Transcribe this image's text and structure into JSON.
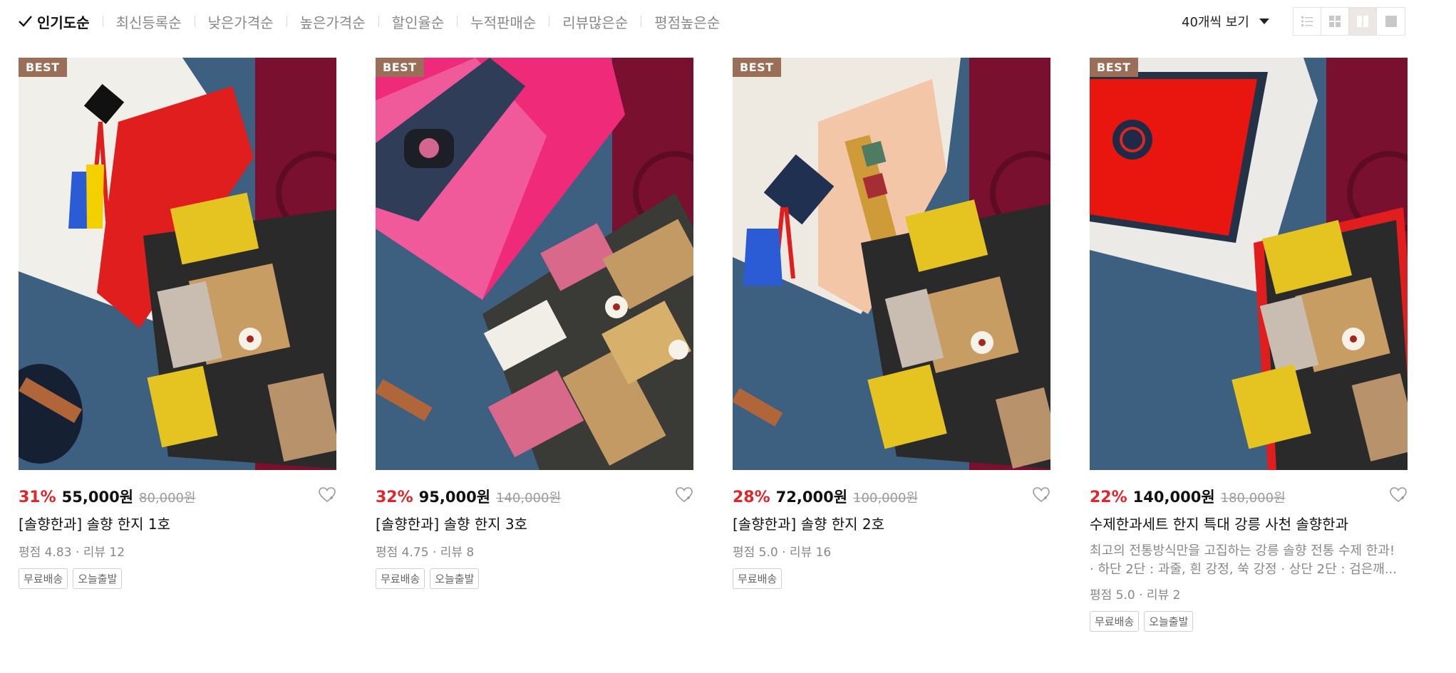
{
  "sort": {
    "options": [
      {
        "label": "인기도순",
        "active": true
      },
      {
        "label": "최신등록순"
      },
      {
        "label": "낮은가격순"
      },
      {
        "label": "높은가격순"
      },
      {
        "label": "할인율순"
      },
      {
        "label": "누적판매순"
      },
      {
        "label": "리뷰많은순"
      },
      {
        "label": "평점높은순"
      }
    ]
  },
  "per_page": {
    "label": "40개씩 보기"
  },
  "view_modes": [
    "list-view-icon",
    "grid-4-view-icon",
    "grid-2-view-icon",
    "single-view-icon"
  ],
  "colors": {
    "accent": "#e0262b",
    "badge": "#9b6e57",
    "background_cloth": "#3d5f80",
    "runner": "#7a1030"
  },
  "products": [
    {
      "badge": "BEST",
      "discount": "31%",
      "price": "55,000원",
      "original_price": "80,000원",
      "title": "[솔향한과] 솔향 한지 1호",
      "rating": "평점 4.83 · 리뷰 12",
      "tags": [
        "무료배송",
        "오늘출발"
      ],
      "image": "hangwa-gift-box-red-wrap"
    },
    {
      "badge": "BEST",
      "discount": "32%",
      "price": "95,000원",
      "original_price": "140,000원",
      "title": "[솔향한과] 솔향 한지 3호",
      "rating": "평점 4.75 · 리뷰 8",
      "tags": [
        "무료배송",
        "오늘출발"
      ],
      "image": "hangwa-gift-box-pink-wrap"
    },
    {
      "badge": "BEST",
      "discount": "28%",
      "price": "72,000원",
      "original_price": "100,000원",
      "title": "[솔향한과] 솔향 한지 2호",
      "rating": "평점 5.0 · 리뷰 16",
      "tags": [
        "무료배송"
      ],
      "image": "hangwa-gift-box-peach-wrap"
    },
    {
      "badge": "BEST",
      "discount": "22%",
      "price": "140,000원",
      "original_price": "180,000원",
      "title": "수제한과세트 한지 특대 강릉 사천 솔향한과",
      "description_lines": [
        "최고의 전통방식만을 고집하는 강릉 솔향 전통 수제 한과!",
        "· 하단 2단 : 과줄, 흰 강정, 쑥 강정 · 상단 2단 : 검은깨..."
      ],
      "rating": "평점 5.0 · 리뷰 2",
      "tags": [
        "무료배송",
        "오늘출발"
      ],
      "image": "hangwa-gift-box-red-lid-frame"
    }
  ]
}
